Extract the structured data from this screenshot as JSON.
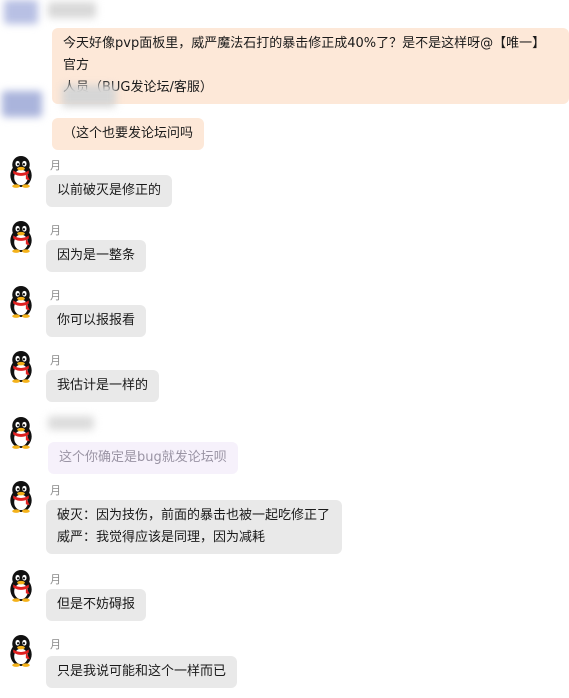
{
  "chat": {
    "messages": [
      {
        "sender": "",
        "lines": [
          "今天好像pvp面板里，威严魔法石打的暴击修正成40%了？是不是这样呀@【唯一】官方",
          "人员（BUG发论坛/客服）"
        ]
      },
      {
        "sender": "",
        "lines": [
          "（这个也要发论坛问吗"
        ]
      },
      {
        "sender": "月",
        "lines": [
          "以前破灭是修正的"
        ]
      },
      {
        "sender": "月",
        "lines": [
          "因为是一整条"
        ]
      },
      {
        "sender": "月",
        "lines": [
          "你可以报报看"
        ]
      },
      {
        "sender": "月",
        "lines": [
          "我估计是一样的"
        ]
      },
      {
        "sender": "",
        "lines": [
          "这个你确定是bug就发论坛呗"
        ]
      },
      {
        "sender": "月",
        "lines": [
          "破灭：因为技伤，前面的暴击也被一起吃修正了",
          "威严：我觉得应该是同理，因为减耗"
        ]
      },
      {
        "sender": "月",
        "lines": [
          "但是不妨碍报"
        ]
      },
      {
        "sender": "月",
        "lines": [
          "只是我说可能和这个一样而已"
        ]
      }
    ]
  },
  "colors": {
    "peach_bubble": "#fde8d8",
    "grey_bubble": "#e9e9e9",
    "faded_bubble": "#f6f1fb",
    "qq_avatar_body": "#000000",
    "qq_avatar_scarf": "#e02020",
    "qq_avatar_beak": "#f4b21b"
  },
  "icons": {
    "avatar": "qq-penguin-icon"
  }
}
